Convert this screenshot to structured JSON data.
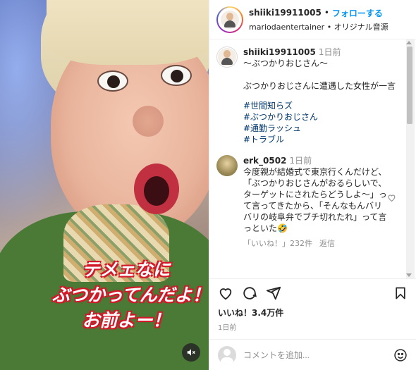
{
  "media": {
    "overlay_lines": [
      "テメェなに",
      "ぶつかってんだよ！",
      "お前よー！"
    ],
    "mute_icon": "speaker-muted-icon"
  },
  "header": {
    "username": "shiiki19911005",
    "separator": "•",
    "follow_label": "フォローする",
    "audio_line": "mariodaentertainer • オリジナル音源"
  },
  "caption": {
    "username": "shiiki19911005",
    "time": "1日前",
    "text": "〜ぶつかりおじさん〜\n\nぶつかりおじさんに遭遇した女性が一言",
    "hashtags": [
      "#世間知らズ",
      "#ぶつかりおじさん",
      "#通勤ラッシュ",
      "#トラブル"
    ]
  },
  "comment": {
    "username": "erk_0502",
    "time": "1日前",
    "text": "今度親が結婚式で東京行くんだけど、「ぶつかりおじさんがおるらしいで、ターゲットにされたらどうしよ〜」って言ってきたから、「そんなもんバリバリの岐阜弁でブチ切れたれ」って言っといた🤣",
    "likes": "「いいね！」232件",
    "reply_label": "返信"
  },
  "actions": {
    "like_icon": "heart-icon",
    "comment_icon": "comment-icon",
    "share_icon": "share-icon",
    "save_icon": "bookmark-icon"
  },
  "likes_text": "いいね！3.4万件",
  "date_text": "1日前",
  "add_comment": {
    "placeholder": "コメントを追加...",
    "emoji_icon": "emoji-icon"
  }
}
